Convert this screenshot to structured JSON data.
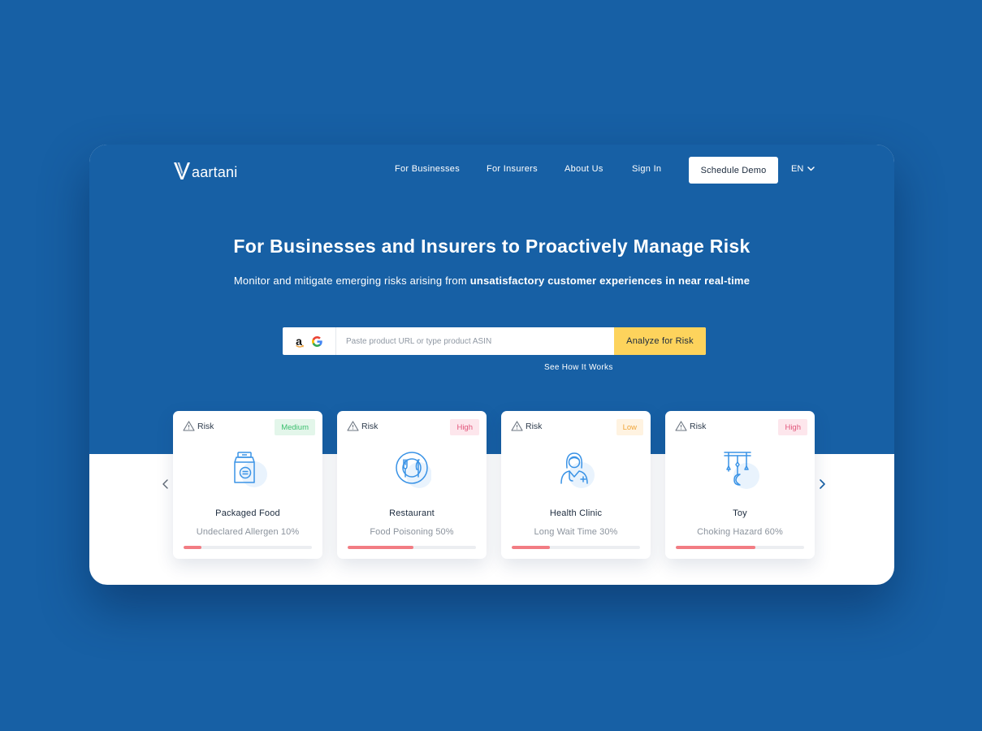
{
  "brand": {
    "name": "aartani"
  },
  "nav": {
    "items": [
      "For Businesses",
      "For Insurers",
      "About Us",
      "Sign In"
    ],
    "cta": "Schedule Demo",
    "language": "EN"
  },
  "hero": {
    "title": "For Businesses and Insurers to Proactively Manage Risk",
    "subtitle_plain": "Monitor and mitigate emerging risks arising from ",
    "subtitle_bold": "unsatisfactory customer experiences in near real-time"
  },
  "search": {
    "placeholder": "Paste product URL or type product ASIN",
    "value": "",
    "button": "Analyze for Risk",
    "sources": [
      "amazon-icon",
      "google-icon"
    ],
    "help_link": "See How It Works"
  },
  "cards": [
    {
      "risk_label": "Risk",
      "level": "Medium",
      "name": "Packaged Food",
      "hazard": "Undeclared Allergen 10%",
      "progress": 0.14,
      "icon": "packaged-food-icon"
    },
    {
      "risk_label": "Risk",
      "level": "High",
      "name": "Restaurant",
      "hazard": "Food Poisoning 50%",
      "progress": 0.51,
      "icon": "restaurant-icon"
    },
    {
      "risk_label": "Risk",
      "level": "Low",
      "name": "Health Clinic",
      "hazard": "Long Wait Time 30%",
      "progress": 0.3,
      "icon": "doctor-icon"
    },
    {
      "risk_label": "Risk",
      "level": "High",
      "name": "Toy",
      "hazard": "Choking Hazard  60%",
      "progress": 0.62,
      "icon": "toy-mobile-icon"
    }
  ],
  "colors": {
    "primary": "#1760a5",
    "accent": "#fdd35c",
    "progress": "#f27c83",
    "icon": "#3a93e6",
    "badge_medium_bg": "#e3f6ea",
    "badge_medium_text": "#3bbf6e",
    "badge_high_bg": "#fde6ec",
    "badge_high_text": "#e2567b",
    "badge_low_bg": "#fff3e1",
    "badge_low_text": "#f0a63a"
  }
}
